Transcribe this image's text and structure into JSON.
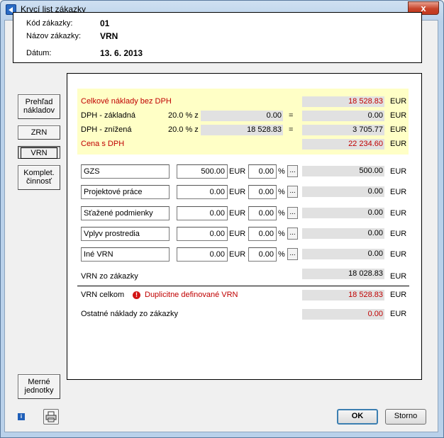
{
  "window": {
    "title": "Krycí list zákazky",
    "close_glyph": "x"
  },
  "header": {
    "kod_label": "Kód zákazky:",
    "kod_value": "01",
    "nazov_label": "Názov zákazky:",
    "nazov_value": "VRN",
    "datum_label": "Dátum:",
    "datum_value": "13. 6. 2013"
  },
  "sidebar": {
    "prehlad_line1": "Prehľad",
    "prehlad_line2": "nákladov",
    "zrn": "ZRN",
    "vrn": "VRN",
    "komplet_line1": "Komplet.",
    "komplet_line2": "činnosť",
    "merne_line1": "Merné",
    "merne_line2": "jednotky"
  },
  "summary": {
    "celkove_label": "Celkové náklady bez DPH",
    "celkove_value": "18 528.83",
    "dph_zakladna_label": "DPH  - základná",
    "dph_zakladna_rate": "20.0 % z",
    "dph_zakladna_base": "0.00",
    "dph_zakladna_value": "0.00",
    "dph_znizena_label": "DPH  - znížená",
    "dph_znizena_rate": "20.0 % z",
    "dph_znizena_base": "18 528.83",
    "dph_znizena_value": "3 705.77",
    "cena_label": "Cena s DPH",
    "cena_value": "22 234.60",
    "equals": "=",
    "currency": "EUR"
  },
  "vrn_rows": [
    {
      "name": "GZS",
      "amount": "500.00",
      "percent": "0.00",
      "result": "500.00"
    },
    {
      "name": "Projektové práce",
      "amount": "0.00",
      "percent": "0.00",
      "result": "0.00"
    },
    {
      "name": "Sťažené podmienky",
      "amount": "0.00",
      "percent": "0.00",
      "result": "0.00"
    },
    {
      "name": "Vplyv prostredia",
      "amount": "0.00",
      "percent": "0.00",
      "result": "0.00"
    },
    {
      "name": "Iné VRN",
      "amount": "0.00",
      "percent": "0.00",
      "result": "0.00"
    }
  ],
  "row_labels": {
    "eur": "EUR",
    "percent_sign": "%",
    "dots": "..."
  },
  "totals": {
    "vrn_zo_zakazky_label": "VRN zo zákazky",
    "vrn_zo_zakazky_value": "18 028.83",
    "vrn_celkom_label": "VRN celkom",
    "warning_text": "Duplicitne definované VRN",
    "vrn_celkom_value": "18 528.83",
    "ostatne_label": "Ostatné náklady zo zákazky",
    "ostatne_value": "0.00",
    "currency": "EUR"
  },
  "footer": {
    "ok": "OK",
    "storno": "Storno",
    "info_glyph": "i"
  },
  "colors": {
    "red_text": "#c00000",
    "yellow_panel": "#ffffc6",
    "readonly_bg": "#e1e1e1"
  }
}
